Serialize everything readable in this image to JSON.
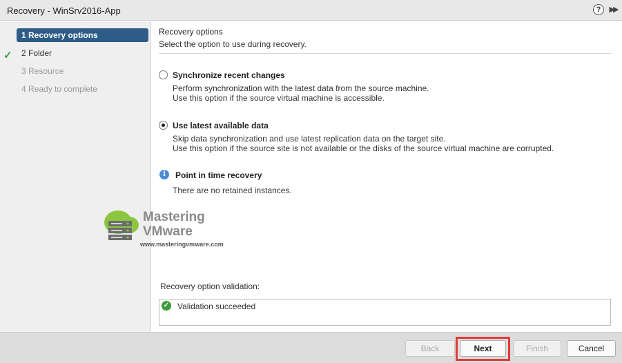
{
  "window": {
    "title": "Recovery - WinSrv2016-App",
    "help_icon": "?",
    "expand_icon": "▶▶"
  },
  "sidebar": {
    "steps": [
      {
        "label": "1  Recovery options",
        "state": "active",
        "completed": true
      },
      {
        "label": "2  Folder",
        "state": "enabled"
      },
      {
        "label": "3  Resource",
        "state": "disabled"
      },
      {
        "label": "4  Ready to complete",
        "state": "disabled"
      }
    ]
  },
  "main": {
    "title": "Recovery options",
    "subtitle": "Select the option to use during recovery.",
    "options": [
      {
        "label": "Synchronize recent changes",
        "selected": false,
        "desc1": "Perform synchronization with the latest data from the source machine.",
        "desc2": "Use this option if the source virtual machine is accessible."
      },
      {
        "label": "Use latest available data",
        "selected": true,
        "desc1": "Skip data synchronization and use latest replication data on the target site.",
        "desc2": "Use this option if the source site is not available or the disks of the source virtual machine are corrupted."
      }
    ],
    "pit": {
      "icon": "i",
      "label": "Point in time recovery",
      "desc": "There are no retained instances."
    },
    "validation": {
      "label": "Recovery option validation:",
      "status": "Validation succeeded",
      "icon": "✓"
    }
  },
  "watermark": {
    "line1": "Mastering",
    "line2": "VMware",
    "url": "www.masteringvmware.com"
  },
  "footer": {
    "back": "Back",
    "next": "Next",
    "finish": "Finish",
    "cancel": "Cancel"
  },
  "colors": {
    "active_step": "#2d5c87",
    "success": "#3a9b3a",
    "info": "#4a8bd6",
    "highlight": "#e23a3a"
  }
}
